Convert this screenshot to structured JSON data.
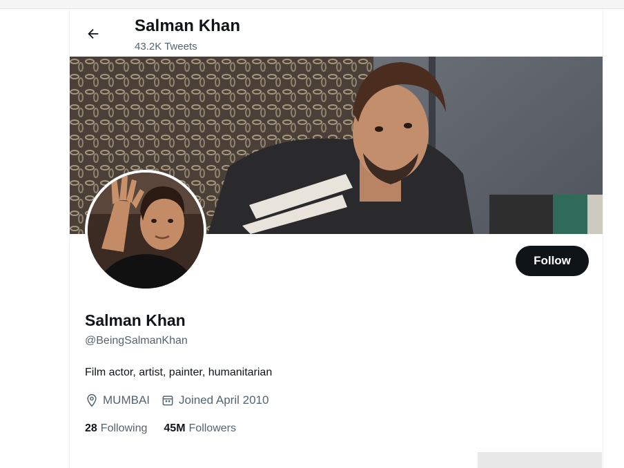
{
  "header": {
    "title": "Salman Khan",
    "tweet_count": "43.2K Tweets"
  },
  "profile": {
    "name": "Salman Khan",
    "handle": "@BeingSalmanKhan",
    "bio": "Film actor, artist, painter, humanitarian",
    "location": "MUMBAI",
    "joined": "Joined April 2010",
    "following_count": "28",
    "following_label": "Following",
    "followers_count": "45M",
    "followers_label": "Followers"
  },
  "actions": {
    "follow_label": "Follow"
  },
  "icons": {
    "back": "arrow-left-icon",
    "location": "location-pin-icon",
    "joined": "calendar-icon"
  },
  "colors": {
    "text_primary": "#0f1419",
    "text_secondary": "#536471",
    "follow_bg": "#0f1419"
  }
}
